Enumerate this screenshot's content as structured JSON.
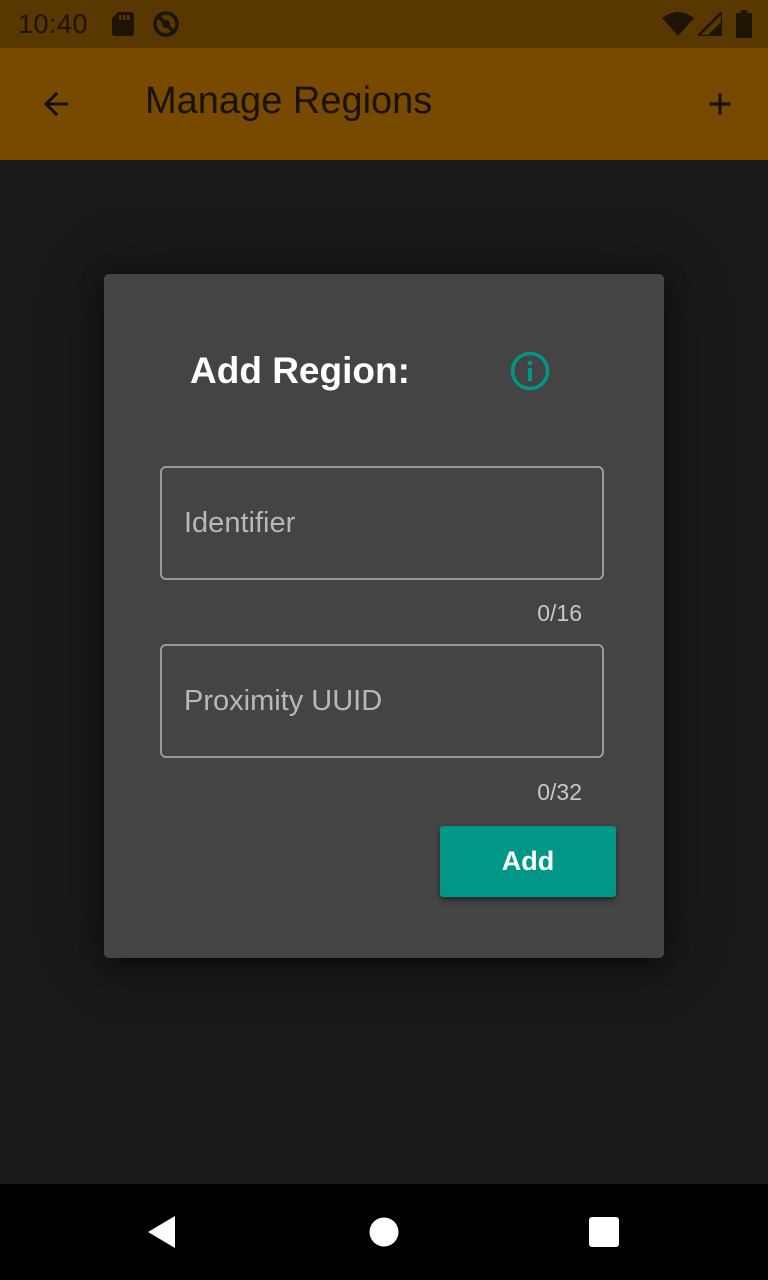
{
  "status_bar": {
    "time": "10:40",
    "icons": [
      "sd-card-icon",
      "sync-disabled-icon",
      "wifi-icon",
      "signal-icon",
      "battery-icon"
    ]
  },
  "app_bar": {
    "title": "Manage Regions",
    "back_icon": "arrow-back-icon",
    "add_icon": "plus-icon",
    "color": "#774a00"
  },
  "dialog": {
    "title": "Add Region:",
    "info_icon": "info-icon",
    "accent_color": "#009688",
    "fields": [
      {
        "placeholder": "Identifier",
        "value": "",
        "counter": "0/16"
      },
      {
        "placeholder": "Proximity UUID",
        "value": "",
        "counter": "0/32"
      }
    ],
    "add_button_label": "Add"
  },
  "nav_bar": {
    "icons": [
      "nav-back-icon",
      "nav-home-icon",
      "nav-recents-icon"
    ]
  }
}
